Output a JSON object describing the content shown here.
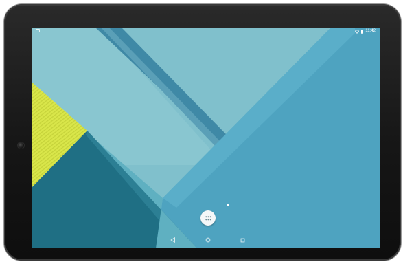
{
  "status_bar": {
    "time": "11:42"
  },
  "icons": {
    "notification": "screenshot-notification-icon",
    "wifi": "wifi-icon",
    "battery": "battery-icon",
    "all_apps": "app-drawer-icon",
    "back": "back-triangle-icon",
    "home": "home-circle-icon",
    "recents": "recents-square-icon"
  },
  "colors": {
    "wallpaper_light": "#80c0cc",
    "wallpaper_mid": "#4ea3c0",
    "wallpaper_dark": "#1f6f84",
    "stripe": "#3f89a6",
    "accent_yellow": "#d9e64a",
    "bezel": "#1a1a1a"
  }
}
